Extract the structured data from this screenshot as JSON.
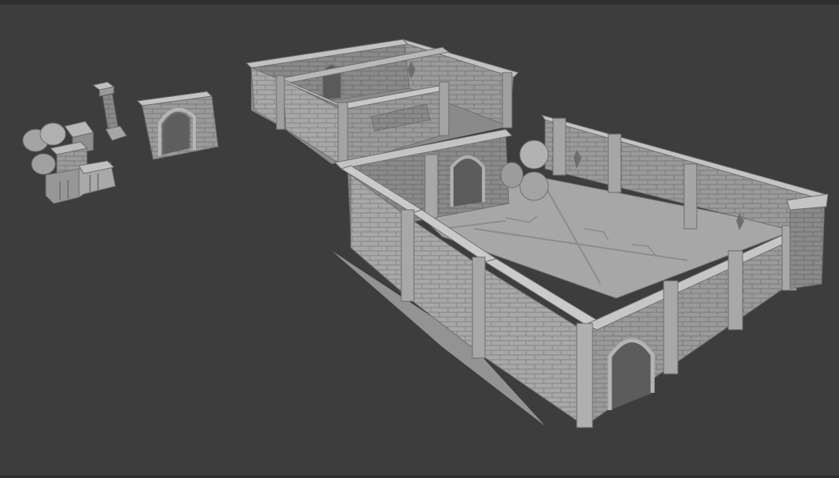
{
  "viewport": {
    "background_color": "#3d3d3d",
    "frame_color": "#303030",
    "model_light_color": "#b4b4b4",
    "model_mid_color": "#8e8e8e",
    "model_dark_color": "#6b6b6b"
  },
  "scene": {
    "objects": [
      {
        "icon": "crates-and-barrels-prop"
      },
      {
        "icon": "stone-pillar-prop"
      },
      {
        "icon": "arched-wall-segment-prop"
      },
      {
        "icon": "dungeon-back-room"
      },
      {
        "icon": "dungeon-main-room"
      }
    ]
  }
}
